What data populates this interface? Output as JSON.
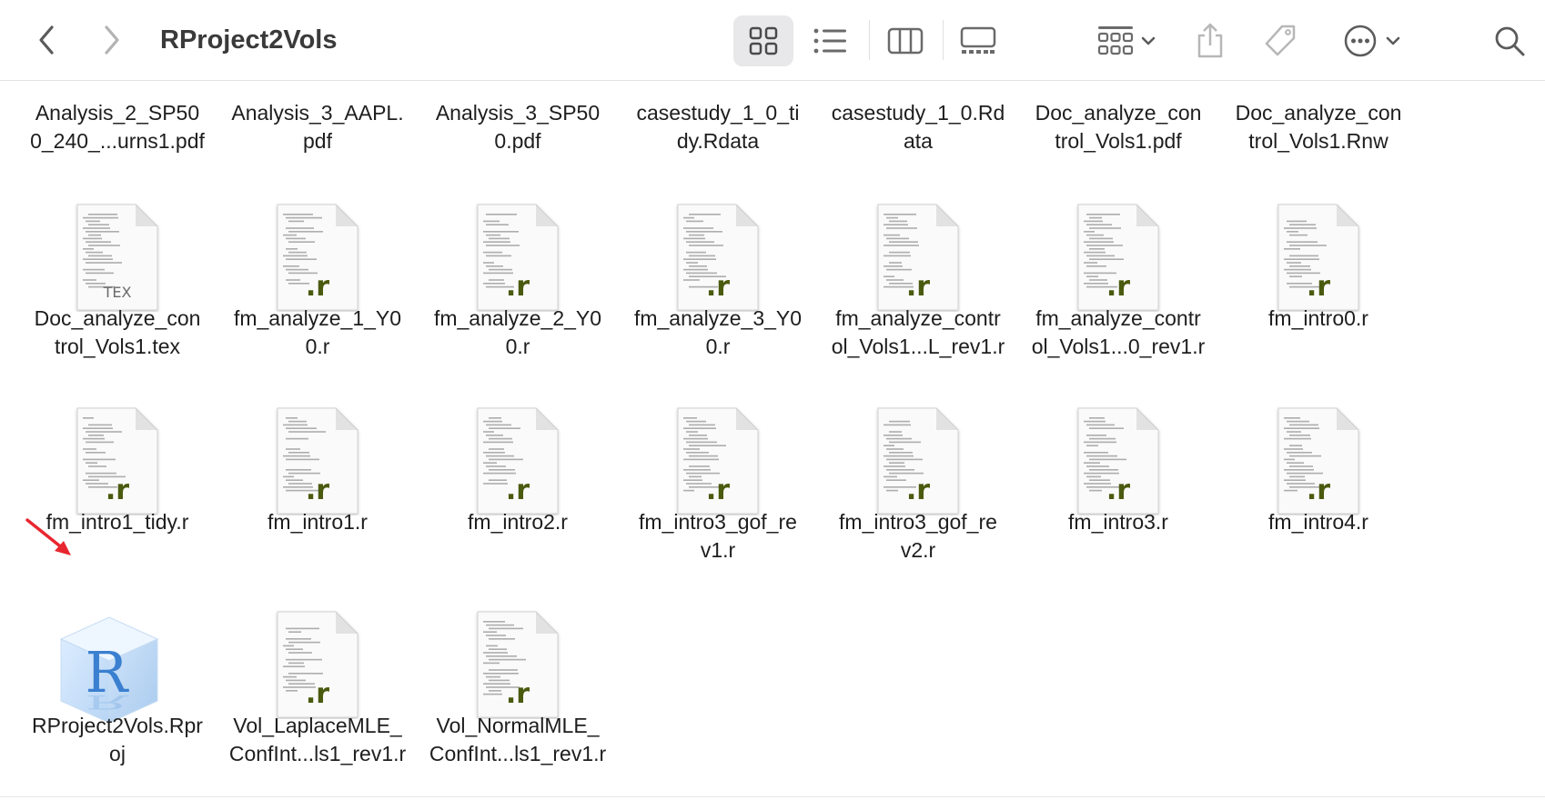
{
  "window": {
    "title": "RProject2Vols"
  },
  "toolbar": {
    "back_icon": "chevron-left-icon",
    "forward_icon": "chevron-right-icon",
    "view_icons": [
      "icon-view-grid-icon",
      "list-view-icon",
      "column-view-icon",
      "gallery-view-icon"
    ],
    "group_icon": "group-by-icon",
    "share_icon": "share-icon",
    "tag_icon": "tag-icon",
    "more_icon": "ellipsis-circle-icon",
    "search_icon": "search-icon"
  },
  "files": {
    "row0": [
      {
        "line1": "Analysis_2_SP50",
        "line2": "0_240_...urns1.pdf"
      },
      {
        "line1": "Analysis_3_AAPL.",
        "line2": "pdf"
      },
      {
        "line1": "Analysis_3_SP50",
        "line2": "0.pdf"
      },
      {
        "line1": "casestudy_1_0_ti",
        "line2": "dy.Rdata"
      },
      {
        "line1": "casestudy_1_0.Rd",
        "line2": "ata"
      },
      {
        "line1": "Doc_analyze_con",
        "line2": "trol_Vols1.pdf"
      },
      {
        "line1": "Doc_analyze_con",
        "line2": "trol_Vols1.Rnw"
      }
    ],
    "row1": [
      {
        "line1": "Doc_analyze_con",
        "line2": "trol_Vols1.tex",
        "badge": "TEX"
      },
      {
        "line1": "fm_analyze_1_Y0",
        "line2": "0.r",
        "badge": ".r"
      },
      {
        "line1": "fm_analyze_2_Y0",
        "line2": "0.r",
        "badge": ".r"
      },
      {
        "line1": "fm_analyze_3_Y0",
        "line2": "0.r",
        "badge": ".r"
      },
      {
        "line1": "fm_analyze_contr",
        "line2": "ol_Vols1...L_rev1.r",
        "badge": ".r"
      },
      {
        "line1": "fm_analyze_contr",
        "line2": "ol_Vols1...0_rev1.r",
        "badge": ".r"
      },
      {
        "line1": "fm_intro0.r",
        "line2": "",
        "badge": ".r"
      }
    ],
    "row2": [
      {
        "line1": "fm_intro1_tidy.r",
        "line2": "",
        "badge": ".r"
      },
      {
        "line1": "fm_intro1.r",
        "line2": "",
        "badge": ".r"
      },
      {
        "line1": "fm_intro2.r",
        "line2": "",
        "badge": ".r"
      },
      {
        "line1": "fm_intro3_gof_re",
        "line2": "v1.r",
        "badge": ".r"
      },
      {
        "line1": "fm_intro3_gof_re",
        "line2": "v2.r",
        "badge": ".r"
      },
      {
        "line1": "fm_intro3.r",
        "line2": "",
        "badge": ".r"
      },
      {
        "line1": "fm_intro4.r",
        "line2": "",
        "badge": ".r"
      }
    ],
    "row3": [
      {
        "line1": "RProject2Vols.Rpr",
        "line2": "oj",
        "icon_letter": "R"
      },
      {
        "line1": "Vol_LaplaceMLE_",
        "line2": "ConfInt...ls1_rev1.r",
        "badge": ".r"
      },
      {
        "line1": "Vol_NormalMLE_",
        "line2": "ConfInt...ls1_rev1.r",
        "badge": ".r"
      }
    ]
  },
  "colors": {
    "r_badge": "#4a5a0f",
    "tex_badge": "#6b6b6b",
    "annotation_arrow": "#e8262f",
    "rproj_blue": "#3a7fd0"
  }
}
